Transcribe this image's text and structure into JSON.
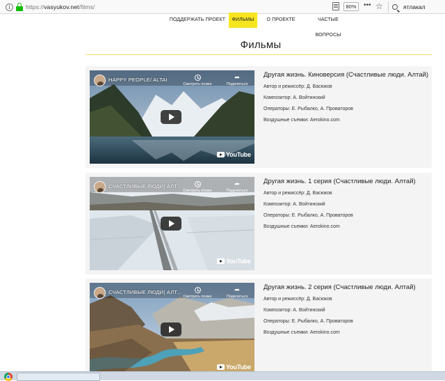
{
  "browser": {
    "url_prefix": "https://",
    "url_domain": "vasyukov.net",
    "url_path": "/films/",
    "zoom": "80%",
    "more_actions": "•••",
    "bookmark_star": "☆",
    "search_value": "ятлакал"
  },
  "nav": {
    "items": [
      {
        "label": "ПОДДЕРЖАТЬ ПРОЕКТ",
        "active": false
      },
      {
        "label": "ФИЛЬМЫ",
        "active": true
      },
      {
        "label": "О ПРОЕКТЕ",
        "active": false
      },
      {
        "label": "ЧАСТЫЕ ВОПРОСЫ",
        "active": false
      }
    ],
    "active_color": "#f6e51f"
  },
  "page_title": "Фильмы",
  "video_overlay": {
    "watch_later": "Смотреть позже",
    "share": "Поделиться",
    "logo": "YouTube"
  },
  "films": [
    {
      "video_title": "HAPPY PEOPLE/ ALTAI",
      "title": "Другая жизнь. Киноверсия (Счастливые люди. Алтай)",
      "director": "Автор и режиссёр: Д. Васюков",
      "composer": "Композитор: А. Войтинский",
      "operators": "Операторы: Е. Рыбалко, А. Проваторов",
      "aerial": "Воздушные съемки: Aerokino.com"
    },
    {
      "video_title": "СЧАСТЛИВЫЕ ЛЮДИ| АЛТ...",
      "title": "Другая жизнь. 1 серия (Счастливые люди. Алтай)",
      "director": "Автор и режиссёр: Д. Васюков",
      "composer": "Композитор: А. Войтинский",
      "operators": "Операторы: Е. Рыбалко, А. Проваторов",
      "aerial": "Воздушные съемки: Aerokino.com"
    },
    {
      "video_title": "СЧАСТЛИВЫЕ ЛЮДИ| АЛТ...",
      "title": "Другая жизнь. 2 серия (Счастливые люди. Алтай)",
      "director": "Автор и режиссёр: Д. Васюков",
      "composer": "Композитор: А. Войтинский",
      "operators": "Операторы: Е. Рыбалко, А. Проваторов",
      "aerial": "Воздушные съемки: Aerokino.com"
    }
  ]
}
